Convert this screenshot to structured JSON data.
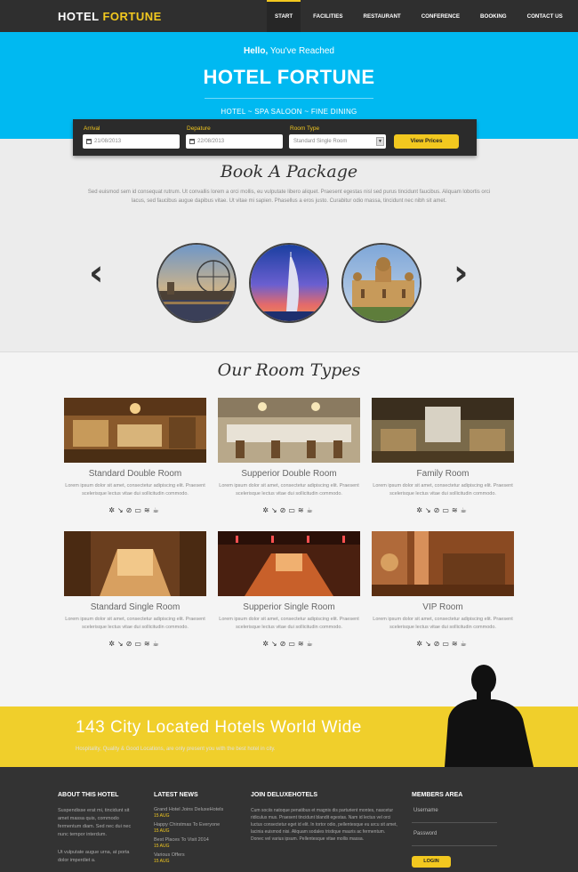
{
  "brand": {
    "first": "HOTEL",
    "second": "FORTUNE"
  },
  "menu": [
    "START",
    "FACILITIES",
    "RESTAURANT",
    "CONFERENCE",
    "BOOKING",
    "CONTACT US"
  ],
  "hero": {
    "hello": "Hello,",
    "reached": " You've Reached",
    "title": "HOTEL FORTUNE",
    "sub": "HOTEL  ~  SPA SALOON  ~  FINE DINING"
  },
  "booking": {
    "arrival_label": "Arrival",
    "arrival_value": "21/08/2013",
    "departure_label": "Depature",
    "departure_value": "22/08/2013",
    "room_label": "Room Type",
    "room_value": "Standard Single Room",
    "button": "View Prices"
  },
  "package": {
    "title": "Book A Package",
    "text": "Sed euismod sem id consequat rutrum. Ut convallis lorem a orci mollis, eu vulputate libero aliquet. Praesent egestas nisl sed purus tincidunt faucibus. Aliquam lobortis orci lacus, sed faucibus augue dapibus vitae. Ut vitae mi sapien. Phasellus a eros justo. Curabitur odio massa, tincidunt nec nibh sit amet."
  },
  "rooms": {
    "title": "Our Room Types",
    "items": [
      {
        "name": "Standard Double Room",
        "desc": "Lorem ipsum dolor sit amet, consectetur adipiscing elit. Praesent scelerisque lectus vitae dui sollicitudin commodo."
      },
      {
        "name": "Supperior Double Room",
        "desc": "Lorem ipsum dolor sit amet, consectetur adipiscing elit. Praesent scelerisque lectus vitae dui sollicitudin commodo."
      },
      {
        "name": "Family Room",
        "desc": "Lorem ipsum dolor sit amet, consectetur adipiscing elit. Praesent scelerisque lectus vitae dui sollicitudin commodo."
      },
      {
        "name": "Standard Single Room",
        "desc": "Lorem ipsum dolor sit amet, consectetur adipiscing elit. Praesent scelerisque lectus vitae dui sollicitudin commodo."
      },
      {
        "name": "Supperior Single Room",
        "desc": "Lorem ipsum dolor sit amet, consectetur adipiscing elit. Praesent scelerisque lectus vitae dui sollicitudin commodo."
      },
      {
        "name": "VIP Room",
        "desc": "Lorem ipsum dolor sit amet, consectetur adipiscing elit. Praesent scelerisque lectus vitae dui sollicitudin commodo."
      }
    ]
  },
  "amenities_icons": [
    "fan-icon",
    "hairdryer-icon",
    "no-smoking-icon",
    "tv-icon",
    "wifi-icon",
    "coffee-icon"
  ],
  "band": {
    "title": "143 City Located Hotels World Wide",
    "sub": "Hospitality, Quality & Good Locations, are only present you with the best hotel in city."
  },
  "footer": {
    "about_title": "ABOUT THIS HOTEL",
    "about_text": "Suspendisse erat mi, tincidunt sit amet massa quis, commodo fermentum diam. Sed nec dui nec nunc tempor interdum.",
    "about_text2": "Ut vulputate augue urna, at porta dolor imperdiet a.",
    "news_title": "LATEST NEWS",
    "news": [
      {
        "title": "Grand Hotel Joins DeluxeHotels",
        "date": "15 AUG"
      },
      {
        "title": "Happy Chirstmas To Everyone",
        "date": "15 AUG"
      },
      {
        "title": "Best Places To Visit 2014",
        "date": "15 AUG"
      },
      {
        "title": "Various Offers",
        "date": "15 AUG"
      }
    ],
    "join_title": "JOIN DELUXEHOTELS",
    "join_text": "Cum sociis natoque penatibus et magnis dis parturient montes, nascetur ridiculus mus. Praesent tincidunt blandit egestas. Nam id lectus vel orci luctus consectetur eget id elit. In tortor odio, pellentesque eu arcu sit amet, lacinia euismod nisi. Aliquam sodales tristique mauris ac fermentum. Donec vel varius ipsum. Pellentesque vitae mollis massa.",
    "members_title": "MEMBERS AREA",
    "username_label": "Username",
    "password_label": "Password",
    "login": "LOGIN"
  },
  "colors": {
    "accent": "#f2c81f",
    "hero": "#00b9f1",
    "nav": "#2f2f2f",
    "footer": "#333333"
  }
}
